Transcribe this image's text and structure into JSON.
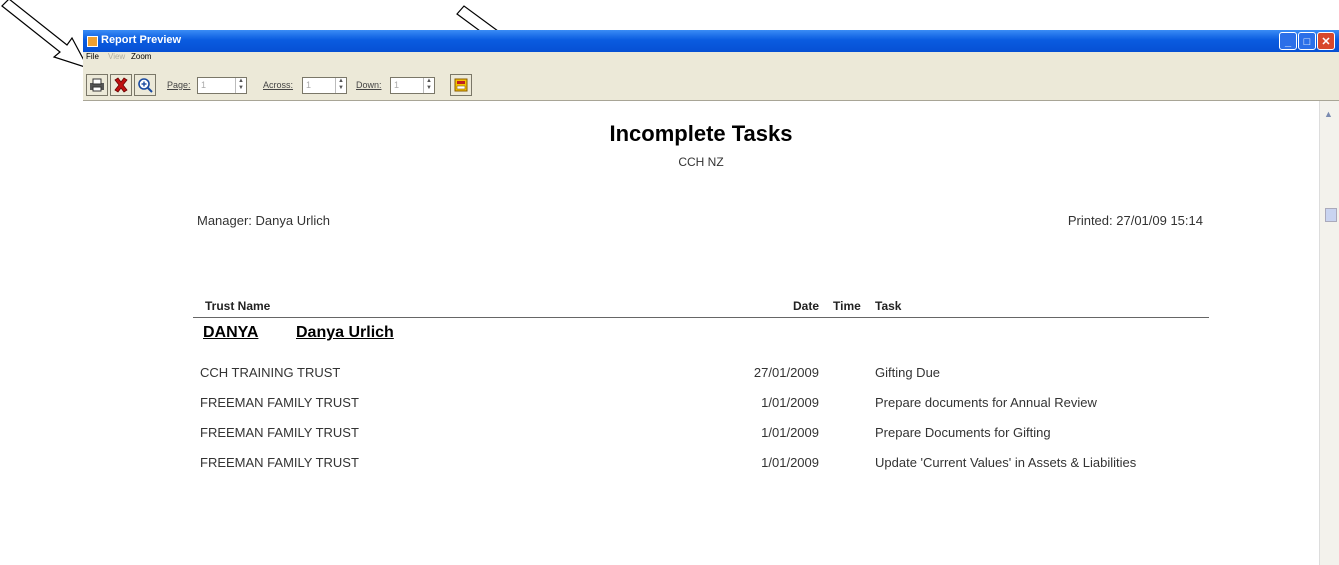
{
  "window": {
    "title": "Report Preview"
  },
  "menu": [
    {
      "label": "File",
      "enabled": true
    },
    {
      "label": "View",
      "enabled": false
    },
    {
      "label": "Zoom",
      "enabled": true
    }
  ],
  "toolbar": {
    "page_label": "Page:",
    "page_value": "1",
    "across_label": "Across:",
    "across_value": "1",
    "down_label": "Down:",
    "down_value": "1"
  },
  "report": {
    "title": "Incomplete Tasks",
    "subtitle": "CCH NZ",
    "manager": "Manager: Danya Urlich",
    "printed": "Printed: 27/01/09   15:14",
    "columns": {
      "trust": "Trust Name",
      "date": "Date",
      "time": "Time",
      "task": "Task"
    },
    "group": {
      "code": "DANYA",
      "name": "Danya Urlich"
    },
    "rows": [
      {
        "trust": "CCH TRAINING TRUST",
        "date": "27/01/2009",
        "time": "",
        "task": "Gifting Due"
      },
      {
        "trust": "FREEMAN FAMILY TRUST",
        "date": "1/01/2009",
        "time": "",
        "task": "Prepare documents for Annual Review"
      },
      {
        "trust": "FREEMAN FAMILY TRUST",
        "date": "1/01/2009",
        "time": "",
        "task": "Prepare Documents for Gifting"
      },
      {
        "trust": "FREEMAN FAMILY TRUST",
        "date": "1/01/2009",
        "time": "",
        "task": "Update 'Current Values' in Assets & Liabilities"
      }
    ]
  },
  "icons": {
    "print": "printer-icon",
    "close": "close-icon",
    "zoom": "zoom-in-icon",
    "export": "export-icon",
    "arrows": "annotation-arrow-icon"
  }
}
